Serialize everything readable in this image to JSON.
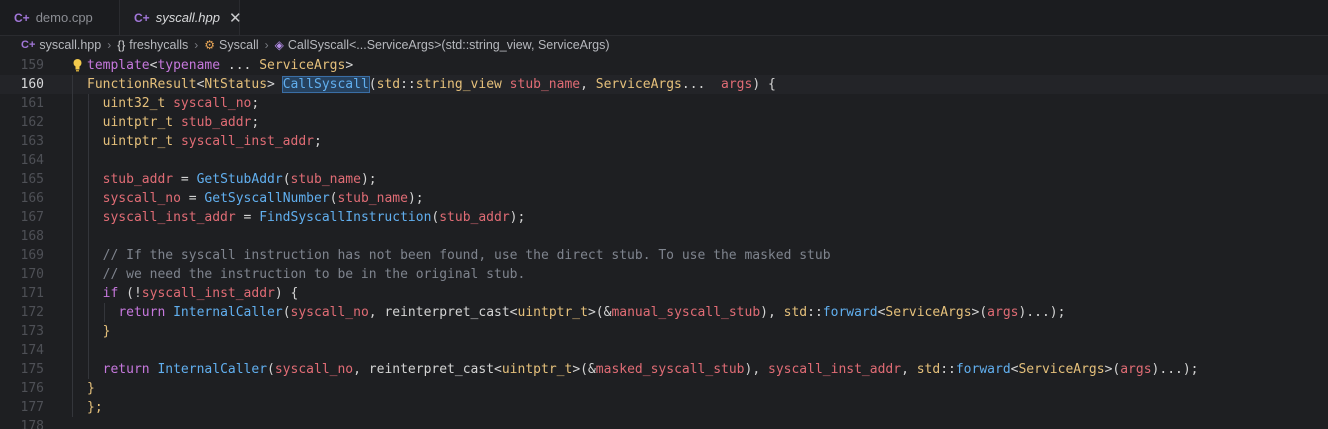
{
  "tabs": [
    {
      "icon": "cpp-file-icon",
      "label": "demo.cpp",
      "active": false
    },
    {
      "icon": "cpp-file-icon",
      "label": "syscall.hpp",
      "active": true,
      "close": "✕"
    }
  ],
  "breadcrumb": {
    "file": "syscall.hpp",
    "namespace": "freshycalls",
    "struct": "Syscall",
    "method": "CallSyscall<...ServiceArgs>(std::string_view, ServiceArgs)"
  },
  "editor": {
    "current_line": "160",
    "lines": [
      {
        "n": "159",
        "tokens": [
          {
            "c": "kw",
            "t": "template"
          },
          {
            "c": "pl",
            "t": "<"
          },
          {
            "c": "kw",
            "t": "typename"
          },
          {
            "c": "pl",
            "t": " ... "
          },
          {
            "c": "ty",
            "t": "ServiceArgs"
          },
          {
            "c": "pl",
            "t": ">"
          }
        ]
      },
      {
        "n": "160",
        "tokens": [
          {
            "c": "ty",
            "t": "FunctionResult"
          },
          {
            "c": "pl",
            "t": "<"
          },
          {
            "c": "ty",
            "t": "NtStatus"
          },
          {
            "c": "pl",
            "t": "> "
          },
          {
            "c": "fn sel",
            "t": "CallSyscall"
          },
          {
            "c": "pl",
            "t": "("
          },
          {
            "c": "ty",
            "t": "std"
          },
          {
            "c": "pl",
            "t": "::"
          },
          {
            "c": "ty",
            "t": "string_view"
          },
          {
            "c": "pl",
            "t": " "
          },
          {
            "c": "var",
            "t": "stub_name"
          },
          {
            "c": "pl",
            "t": ", "
          },
          {
            "c": "ty",
            "t": "ServiceArgs"
          },
          {
            "c": "pl",
            "t": "...  "
          },
          {
            "c": "var",
            "t": "args"
          },
          {
            "c": "pl",
            "t": ") {"
          }
        ]
      },
      {
        "n": "161",
        "tokens": [
          {
            "c": "pl",
            "t": "  "
          },
          {
            "c": "ty",
            "t": "uint32_t"
          },
          {
            "c": "pl",
            "t": " "
          },
          {
            "c": "var",
            "t": "syscall_no"
          },
          {
            "c": "pl",
            "t": ";"
          }
        ]
      },
      {
        "n": "162",
        "tokens": [
          {
            "c": "pl",
            "t": "  "
          },
          {
            "c": "ty",
            "t": "uintptr_t"
          },
          {
            "c": "pl",
            "t": " "
          },
          {
            "c": "var",
            "t": "stub_addr"
          },
          {
            "c": "pl",
            "t": ";"
          }
        ]
      },
      {
        "n": "163",
        "tokens": [
          {
            "c": "pl",
            "t": "  "
          },
          {
            "c": "ty",
            "t": "uintptr_t"
          },
          {
            "c": "pl",
            "t": " "
          },
          {
            "c": "var",
            "t": "syscall_inst_addr"
          },
          {
            "c": "pl",
            "t": ";"
          }
        ]
      },
      {
        "n": "164",
        "tokens": []
      },
      {
        "n": "165",
        "tokens": [
          {
            "c": "pl",
            "t": "  "
          },
          {
            "c": "var",
            "t": "stub_addr"
          },
          {
            "c": "pl",
            "t": " = "
          },
          {
            "c": "fn",
            "t": "GetStubAddr"
          },
          {
            "c": "pl",
            "t": "("
          },
          {
            "c": "var",
            "t": "stub_name"
          },
          {
            "c": "pl",
            "t": ");"
          }
        ]
      },
      {
        "n": "166",
        "tokens": [
          {
            "c": "pl",
            "t": "  "
          },
          {
            "c": "var",
            "t": "syscall_no"
          },
          {
            "c": "pl",
            "t": " = "
          },
          {
            "c": "fn",
            "t": "GetSyscallNumber"
          },
          {
            "c": "pl",
            "t": "("
          },
          {
            "c": "var",
            "t": "stub_name"
          },
          {
            "c": "pl",
            "t": ");"
          }
        ]
      },
      {
        "n": "167",
        "tokens": [
          {
            "c": "pl",
            "t": "  "
          },
          {
            "c": "var",
            "t": "syscall_inst_addr"
          },
          {
            "c": "pl",
            "t": " = "
          },
          {
            "c": "fn",
            "t": "FindSyscallInstruction"
          },
          {
            "c": "pl",
            "t": "("
          },
          {
            "c": "var",
            "t": "stub_addr"
          },
          {
            "c": "pl",
            "t": ");"
          }
        ]
      },
      {
        "n": "168",
        "tokens": []
      },
      {
        "n": "169",
        "tokens": [
          {
            "c": "pl",
            "t": "  "
          },
          {
            "c": "cm",
            "t": "// If the syscall instruction has not been found, use the direct stub. To use the masked stub"
          }
        ]
      },
      {
        "n": "170",
        "tokens": [
          {
            "c": "pl",
            "t": "  "
          },
          {
            "c": "cm",
            "t": "// we need the instruction to be in the original stub."
          }
        ]
      },
      {
        "n": "171",
        "tokens": [
          {
            "c": "pl",
            "t": "  "
          },
          {
            "c": "kw",
            "t": "if"
          },
          {
            "c": "pl",
            "t": " (!"
          },
          {
            "c": "var",
            "t": "syscall_inst_addr"
          },
          {
            "c": "pl",
            "t": ") {"
          }
        ]
      },
      {
        "n": "172",
        "tokens": [
          {
            "c": "pl",
            "t": "    "
          },
          {
            "c": "kw",
            "t": "return"
          },
          {
            "c": "pl",
            "t": " "
          },
          {
            "c": "fn",
            "t": "InternalCaller"
          },
          {
            "c": "pl",
            "t": "("
          },
          {
            "c": "var",
            "t": "syscall_no"
          },
          {
            "c": "pl",
            "t": ", reinterpret_cast<"
          },
          {
            "c": "ty",
            "t": "uintptr_t"
          },
          {
            "c": "pl",
            "t": ">(&"
          },
          {
            "c": "var",
            "t": "manual_syscall_stub"
          },
          {
            "c": "pl",
            "t": "), "
          },
          {
            "c": "ty",
            "t": "std"
          },
          {
            "c": "pl",
            "t": "::"
          },
          {
            "c": "fn",
            "t": "forward"
          },
          {
            "c": "pl",
            "t": "<"
          },
          {
            "c": "ty",
            "t": "ServiceArgs"
          },
          {
            "c": "pl",
            "t": ">("
          },
          {
            "c": "var",
            "t": "args"
          },
          {
            "c": "pl",
            "t": ")...);"
          }
        ]
      },
      {
        "n": "173",
        "tokens": [
          {
            "c": "pl",
            "t": "  "
          },
          {
            "c": "br",
            "t": "}"
          }
        ]
      },
      {
        "n": "174",
        "tokens": []
      },
      {
        "n": "175",
        "tokens": [
          {
            "c": "pl",
            "t": "  "
          },
          {
            "c": "kw",
            "t": "return"
          },
          {
            "c": "pl",
            "t": " "
          },
          {
            "c": "fn",
            "t": "InternalCaller"
          },
          {
            "c": "pl",
            "t": "("
          },
          {
            "c": "var",
            "t": "syscall_no"
          },
          {
            "c": "pl",
            "t": ", reinterpret_cast<"
          },
          {
            "c": "ty",
            "t": "uintptr_t"
          },
          {
            "c": "pl",
            "t": ">(&"
          },
          {
            "c": "var",
            "t": "masked_syscall_stub"
          },
          {
            "c": "pl",
            "t": "), "
          },
          {
            "c": "var",
            "t": "syscall_inst_addr"
          },
          {
            "c": "pl",
            "t": ", "
          },
          {
            "c": "ty",
            "t": "std"
          },
          {
            "c": "pl",
            "t": "::"
          },
          {
            "c": "fn",
            "t": "forward"
          },
          {
            "c": "pl",
            "t": "<"
          },
          {
            "c": "ty",
            "t": "ServiceArgs"
          },
          {
            "c": "pl",
            "t": ">("
          },
          {
            "c": "var",
            "t": "args"
          },
          {
            "c": "pl",
            "t": ")...);"
          }
        ]
      },
      {
        "n": "176",
        "tokens": [
          {
            "c": "br",
            "t": "}"
          }
        ]
      },
      {
        "n": "177",
        "tokens": [
          {
            "c": "br",
            "t": "};"
          }
        ]
      },
      {
        "n": "178",
        "tokens": []
      }
    ]
  }
}
